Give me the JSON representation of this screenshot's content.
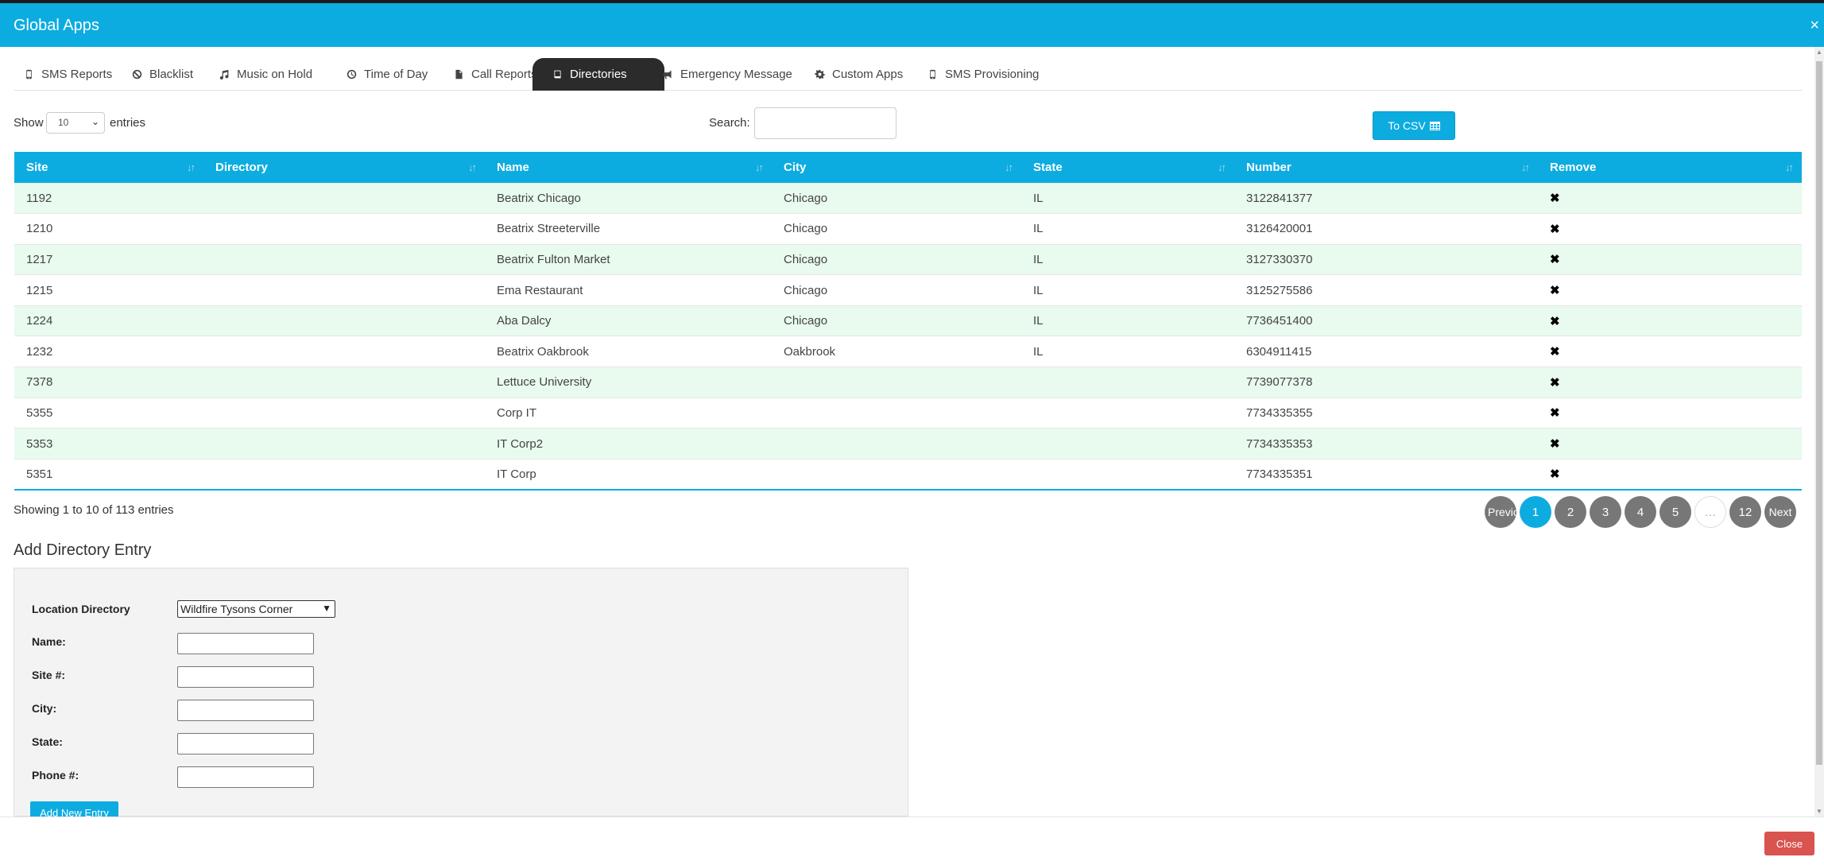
{
  "header": {
    "title": "Global Apps",
    "close_glyph": "×"
  },
  "tabs": [
    {
      "label": "SMS Reports",
      "icon": "mobile-icon"
    },
    {
      "label": "Blacklist",
      "icon": "ban-icon"
    },
    {
      "label": "Music on Hold",
      "icon": "music-icon"
    },
    {
      "label": "Time of Day",
      "icon": "clock-icon"
    },
    {
      "label": "Call Reports",
      "icon": "file-icon"
    },
    {
      "label": "Directories",
      "icon": "book-icon",
      "active": true
    },
    {
      "label": "Emergency Message",
      "icon": "megaphone-icon"
    },
    {
      "label": "Custom Apps",
      "icon": "gear-icon"
    },
    {
      "label": "SMS Provisioning",
      "icon": "mobile-icon"
    }
  ],
  "controls": {
    "show_label": "Show",
    "entries_value": "10",
    "entries_label": "entries",
    "search_label": "Search:",
    "search_value": "",
    "csv_label": "To CSV"
  },
  "table": {
    "columns": [
      "Site",
      "Directory",
      "Name",
      "City",
      "State",
      "Number",
      "Remove"
    ],
    "rows": [
      {
        "site": "1192",
        "directory": "",
        "name": "Beatrix Chicago",
        "city": "Chicago",
        "state": "IL",
        "number": "3122841377"
      },
      {
        "site": "1210",
        "directory": "",
        "name": "Beatrix Streeterville",
        "city": "Chicago",
        "state": "IL",
        "number": "3126420001"
      },
      {
        "site": "1217",
        "directory": "",
        "name": "Beatrix Fulton Market",
        "city": "Chicago",
        "state": "IL",
        "number": "3127330370"
      },
      {
        "site": "1215",
        "directory": "",
        "name": "Ema Restaurant",
        "city": "Chicago",
        "state": "IL",
        "number": "3125275586"
      },
      {
        "site": "1224",
        "directory": "",
        "name": "Aba Dalcy",
        "city": "Chicago",
        "state": "IL",
        "number": "7736451400"
      },
      {
        "site": "1232",
        "directory": "",
        "name": "Beatrix Oakbrook",
        "city": "Oakbrook",
        "state": "IL",
        "number": "6304911415"
      },
      {
        "site": "7378",
        "directory": "",
        "name": "Lettuce University",
        "city": "",
        "state": "",
        "number": "7739077378"
      },
      {
        "site": "5355",
        "directory": "",
        "name": "Corp IT",
        "city": "",
        "state": "",
        "number": "7734335355"
      },
      {
        "site": "5353",
        "directory": "",
        "name": "IT Corp2",
        "city": "",
        "state": "",
        "number": "7734335353"
      },
      {
        "site": "5351",
        "directory": "",
        "name": "IT Corp",
        "city": "",
        "state": "",
        "number": "7734335351"
      }
    ],
    "remove_glyph": "✖",
    "info": "Showing 1 to 10 of 113 entries"
  },
  "pagination": {
    "previous": "Previous",
    "pages": [
      "1",
      "2",
      "3",
      "4",
      "5",
      "…",
      "12"
    ],
    "current": "1",
    "next": "Next"
  },
  "add_form": {
    "title": "Add Directory Entry",
    "location_label": "Location Directory",
    "location_value": "Wildfire Tysons Corner",
    "name_label": "Name:",
    "site_label": "Site #:",
    "city_label": "City:",
    "state_label": "State:",
    "phone_label": "Phone #:",
    "submit_label": "Add New Entry"
  },
  "footer": {
    "close_label": "Close"
  },
  "colors": {
    "accent": "#0dace0",
    "active_tab": "#2b2b2b",
    "row_stripe": "#e8fbee",
    "danger": "#d9534f",
    "pager_gray": "#777777"
  }
}
